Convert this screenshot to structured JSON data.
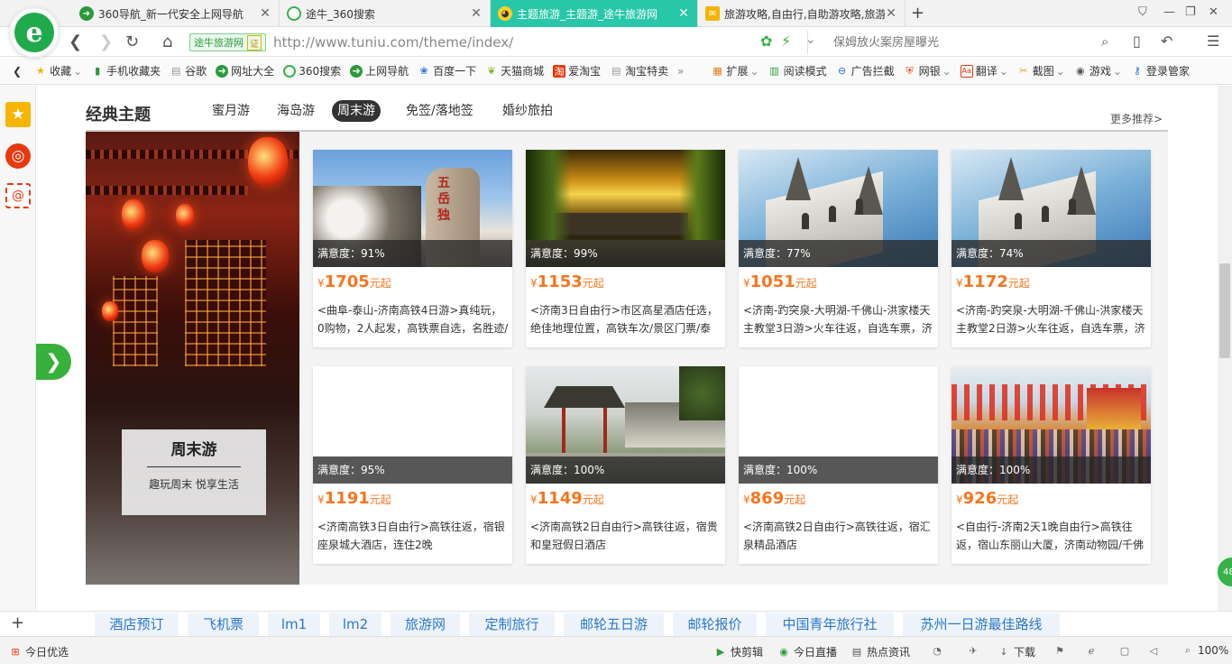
{
  "tabs": [
    {
      "label": "360导航_新一代安全上网导航",
      "icon": "360-nav-icon",
      "color": "#2c9a3a",
      "active": false
    },
    {
      "label": "途牛_360搜索",
      "icon": "360-search-icon",
      "color": "#39b14a",
      "active": false
    },
    {
      "label": "主题旅游_主题游_途牛旅游网",
      "icon": "tuniu-icon",
      "color": "#27c7a8",
      "active": true
    },
    {
      "label": "旅游攻略,自由行,自助游攻略,旅游",
      "icon": "mail-icon",
      "color": "#f5b400",
      "active": false
    }
  ],
  "address": {
    "site_badge": "途牛旅游网",
    "badge_mark": "证",
    "url": "http://www.tuniu.com/theme/index/"
  },
  "search": {
    "placeholder": "保姆放火案房屋曝光"
  },
  "bookmarks": [
    {
      "label": "收藏",
      "icon": "star-icon"
    },
    {
      "label": "手机收藏夹",
      "icon": "phone-icon"
    },
    {
      "label": "谷歌",
      "icon": "page-icon"
    },
    {
      "label": "网址大全",
      "icon": "360-icon"
    },
    {
      "label": "360搜索",
      "icon": "search-icon"
    },
    {
      "label": "上网导航",
      "icon": "360-icon"
    },
    {
      "label": "百度一下",
      "icon": "paw-icon"
    },
    {
      "label": "天猫商城",
      "icon": "leaf-icon"
    },
    {
      "label": "爱淘宝",
      "icon": "taobao-icon"
    },
    {
      "label": "淘宝特卖",
      "icon": "page-icon"
    }
  ],
  "bookmark_tools": [
    {
      "label": "扩展",
      "icon": "grid-icon"
    },
    {
      "label": "阅读模式",
      "icon": "book-icon"
    },
    {
      "label": "广告拦截",
      "icon": "block-icon"
    },
    {
      "label": "网银",
      "icon": "shield-icon"
    },
    {
      "label": "翻译",
      "icon": "translate-icon"
    },
    {
      "label": "截图",
      "icon": "scissors-icon"
    },
    {
      "label": "游戏",
      "icon": "gamepad-icon"
    },
    {
      "label": "登录管家",
      "icon": "key-icon"
    }
  ],
  "section": {
    "title": "经典主题",
    "tabs": [
      "蜜月游",
      "海岛游",
      "周末游",
      "免签/落地签",
      "婚纱旅拍"
    ],
    "active_tab": "周末游",
    "more": "更多推荐>"
  },
  "hero": {
    "title": "周末游",
    "subtitle": "趣玩周末 悦享生活"
  },
  "cards": [
    {
      "sat": "满意度：91%",
      "currency": "¥",
      "price": "1705",
      "suffix": "元起",
      "desc": "<曲阜-泰山-济南高铁4日游>真纯玩，0购物，2人起发，高铁票自选，名胜迹/",
      "image": "taishan-rock"
    },
    {
      "sat": "满意度：99%",
      "currency": "¥",
      "price": "1153",
      "suffix": "元起",
      "desc": "<济南3日自由行>市区高星酒店任选，绝佳地理位置，高铁车次/景区门票/泰",
      "image": "willow-sunset"
    },
    {
      "sat": "满意度：77%",
      "currency": "¥",
      "price": "1051",
      "suffix": "元起",
      "desc": "<济南-趵突泉-大明湖-千佛山-洪家楼天主教堂3日游>火车往返，自选车票，济",
      "image": "church"
    },
    {
      "sat": "满意度：74%",
      "currency": "¥",
      "price": "1172",
      "suffix": "元起",
      "desc": "<济南-趵突泉-大明湖-千佛山-洪家楼天主教堂2日游>火车往返，自选车票，济",
      "image": "church"
    },
    {
      "sat": "满意度：95%",
      "currency": "¥",
      "price": "1191",
      "suffix": "元起",
      "desc": "<济南高铁3日自由行>高铁往返，宿银座泉城大酒店，连住2晚",
      "image": "blank"
    },
    {
      "sat": "满意度：100%",
      "currency": "¥",
      "price": "1149",
      "suffix": "元起",
      "desc": "<济南高铁2日自由行>高铁往返，宿贵和皇冠假日酒店",
      "image": "pavilion"
    },
    {
      "sat": "满意度：100%",
      "currency": "¥",
      "price": "869",
      "suffix": "元起",
      "desc": "<济南高铁2日自由行>高铁往返，宿汇泉精品酒店",
      "image": "blank"
    },
    {
      "sat": "满意度：100%",
      "currency": "¥",
      "price": "926",
      "suffix": "元起",
      "desc": "<自由行-济南2天1晚自由行>高铁往返，宿山东丽山大厦，济南动物园/千佛",
      "image": "festival"
    }
  ],
  "bottom_links": [
    "酒店预订",
    "飞机票",
    "lm1",
    "lm2",
    "旅游网",
    "定制旅行",
    "邮轮五日游",
    "邮轮报价",
    "中国青年旅行社",
    "苏州一日游最佳路线"
  ],
  "status": {
    "left": "今日优选",
    "items": [
      "快剪辑",
      "今日直播",
      "热点资讯",
      "下载"
    ],
    "zoom": "100%",
    "float_badge": "48"
  },
  "colors": {
    "accent": "#37b13b",
    "price": "#f7751e",
    "tab_active": "#27c7a8",
    "link": "#2a78c8"
  }
}
